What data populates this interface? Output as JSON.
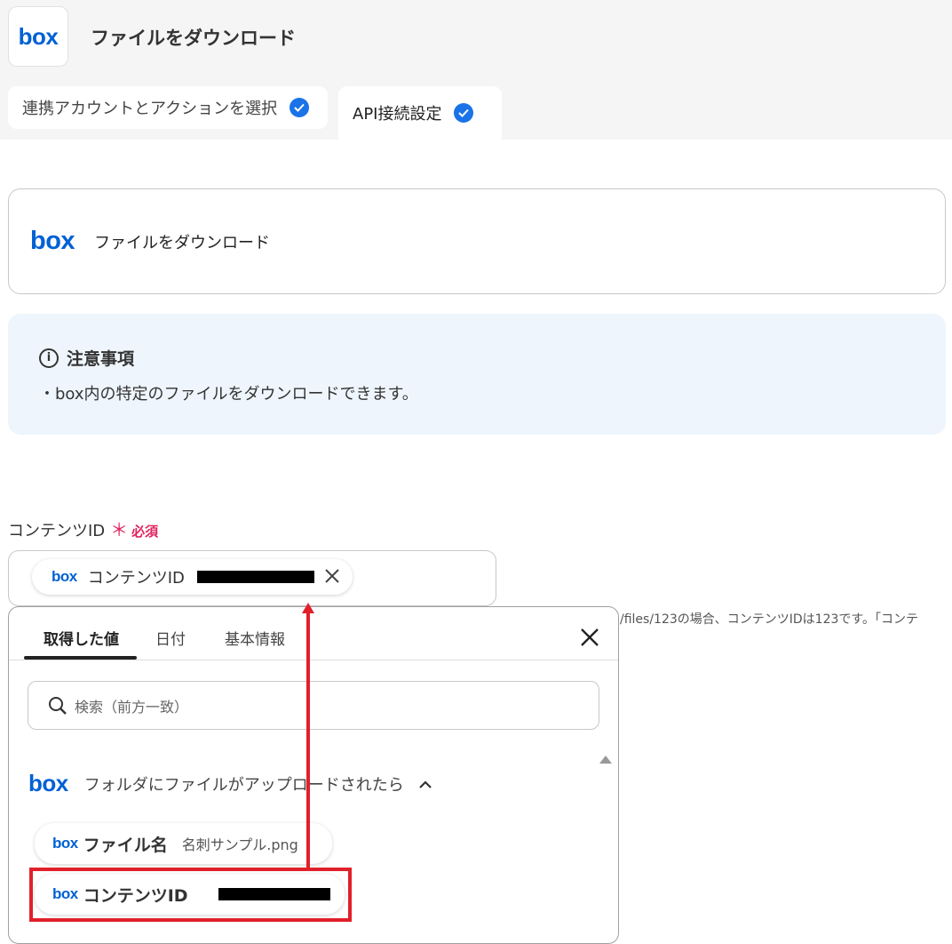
{
  "header": {
    "logo_text": "box",
    "title": "ファイルをダウンロード"
  },
  "tabs": [
    {
      "label": "連携アカウントとアクションを選択",
      "done": true
    },
    {
      "label": "API接続設定",
      "done": true
    }
  ],
  "action_card": {
    "logo_text": "box",
    "title": "ファイルをダウンロード"
  },
  "notice": {
    "heading": "注意事項",
    "text": "・box内の特定のファイルをダウンロードできます。"
  },
  "field": {
    "label": "コンテンツID",
    "required_mark": "＊",
    "required_text": "必須",
    "chip_logo": "box",
    "chip_label": "コンテンツID",
    "help_text": "/files/123の場合、コンテンツIDは123です。「コンテ"
  },
  "picker": {
    "tabs": [
      "取得した値",
      "日付",
      "基本情報"
    ],
    "active_tab": "取得した値",
    "search_placeholder": "検索（前方一致）",
    "group": {
      "logo_text": "box",
      "title": "フォルダにファイルがアップロードされたら"
    },
    "items": [
      {
        "logo": "box",
        "label": "ファイル名",
        "value": "名刺サンプル.png"
      },
      {
        "logo": "box",
        "label": "コンテンツID",
        "value": ""
      }
    ]
  },
  "colors": {
    "accent": "#1a73e8",
    "brand": "#0061d5",
    "required": "#e0245e",
    "annotation": "#e0202a"
  }
}
